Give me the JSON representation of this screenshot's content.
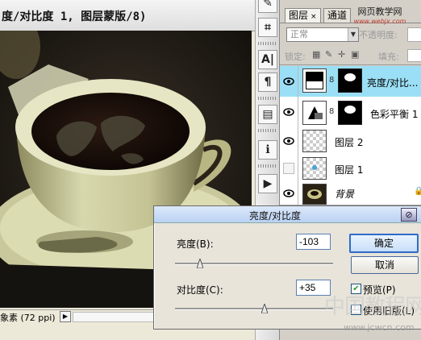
{
  "document": {
    "title": "度/对比度 1, 图层蒙版/8)",
    "status_zoom": "象素 (72 ppi)",
    "status_arrow": "▶"
  },
  "toolbar": {
    "buttons": [
      {
        "icon": "brush-icon",
        "glyph": "✎"
      },
      {
        "icon": "crop-icon",
        "glyph": "⌗"
      },
      {
        "icon": "character-icon",
        "glyph": "A|"
      },
      {
        "icon": "paragraph-icon",
        "glyph": "¶"
      },
      {
        "icon": "notes-icon",
        "glyph": "▤"
      },
      {
        "icon": "info-icon",
        "glyph": "ℹ"
      },
      {
        "icon": "actions-icon",
        "glyph": "▶"
      }
    ]
  },
  "layers_panel": {
    "tabs": [
      {
        "label": "图层",
        "close": "×"
      },
      {
        "label": "通道"
      }
    ],
    "watermark_title": "网页教学网",
    "watermark_url": "www.webjx.com",
    "blend_mode": "正常",
    "opacity_label": "不透明度:",
    "lock_label": "锁定:",
    "fill_label": "填充:",
    "layers": [
      {
        "name": "亮度/对比...",
        "selected": true,
        "visible": true,
        "has_mask": true,
        "thumb": "adjustment-brightness"
      },
      {
        "name": "色彩平衡 1",
        "selected": false,
        "visible": true,
        "has_mask": true,
        "thumb": "adjustment-color-balance"
      },
      {
        "name": "图层 2",
        "selected": false,
        "visible": true,
        "has_mask": false,
        "thumb": "transparent"
      },
      {
        "name": "图层 1",
        "selected": false,
        "visible": false,
        "has_mask": false,
        "thumb": "transparent-mark"
      },
      {
        "name": "背景",
        "selected": false,
        "visible": true,
        "has_mask": false,
        "thumb": "photo",
        "locked": true
      }
    ]
  },
  "dialog": {
    "title": "亮度/对比度",
    "brightness_label": "亮度(B):",
    "brightness_value": "-103",
    "brightness_level": -103,
    "contrast_label": "对比度(C):",
    "contrast_value": "+35",
    "contrast_level": 35,
    "ok_label": "确定",
    "cancel_label": "取消",
    "preview_label": "预览(P)",
    "preview_checked": true,
    "legacy_label": "使用旧版(L)",
    "close_glyph": "⊘"
  },
  "site_watermark": {
    "text": "中国教程网",
    "url": "www.jcwcn.com"
  },
  "colors": {
    "selected_row": "#9bdff6",
    "ok_border": "#2f6bc8"
  }
}
